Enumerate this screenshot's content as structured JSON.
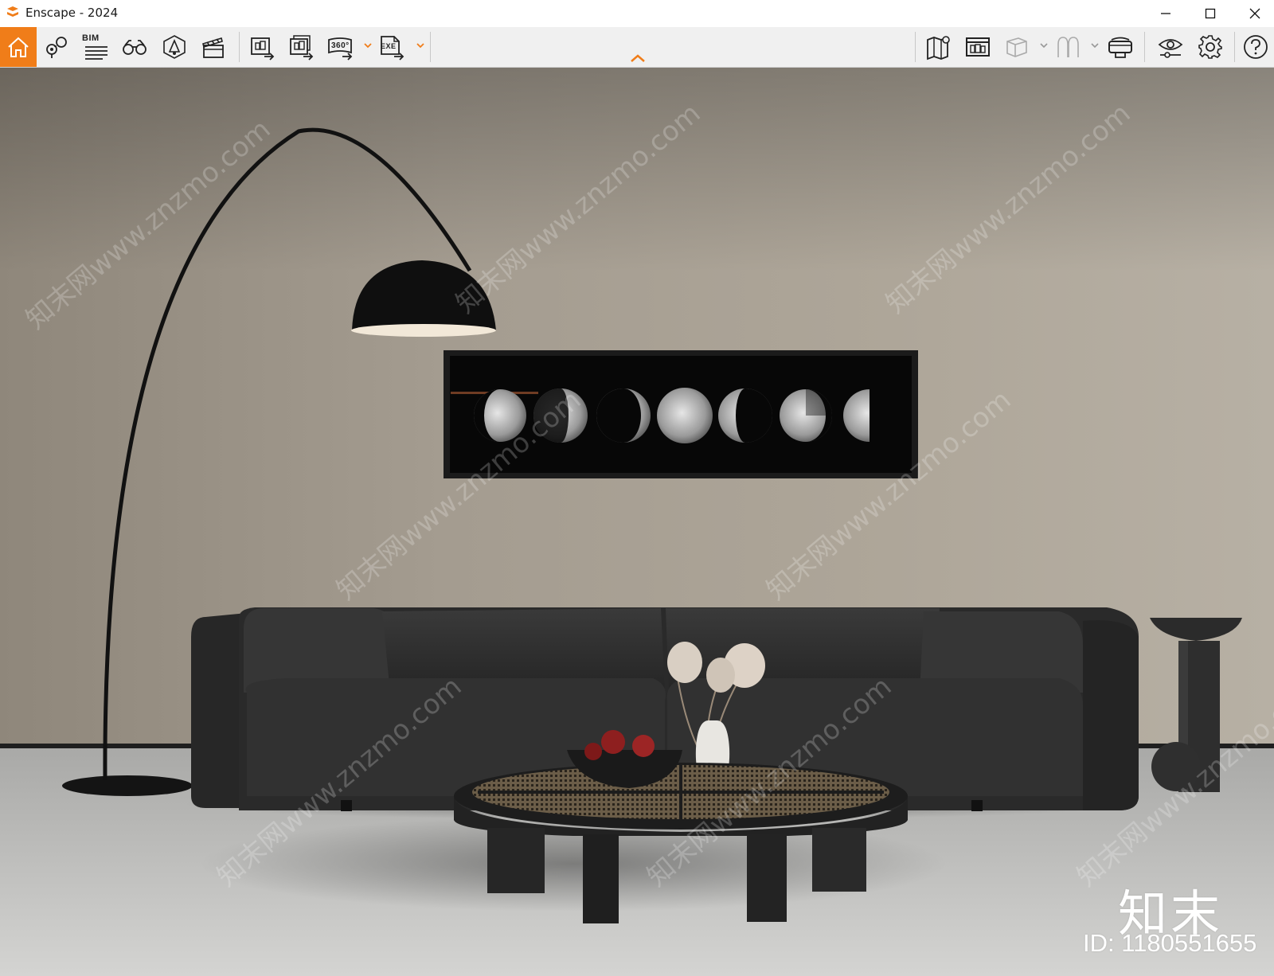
{
  "window": {
    "title": "Enscape - 2024",
    "controls": {
      "minimize": "minimize-icon",
      "maximize": "maximize-icon",
      "close": "close-icon"
    }
  },
  "toolbar": {
    "accent_color": "#f07d19",
    "left_tools": [
      {
        "name": "home",
        "icon": "home-icon"
      },
      {
        "name": "views",
        "icon": "map-pin-views-icon"
      },
      {
        "name": "bim",
        "icon": "bim-info-icon",
        "label": "BIM"
      },
      {
        "name": "binoculars",
        "icon": "binoculars-icon"
      },
      {
        "name": "light-view",
        "icon": "light-view-icon"
      },
      {
        "name": "video-editor",
        "icon": "clapperboard-icon"
      },
      {
        "name": "render-screenshot",
        "icon": "render-screenshot-icon"
      },
      {
        "name": "batch-render",
        "icon": "batch-render-icon"
      },
      {
        "name": "panorama",
        "icon": "panorama-360-icon",
        "label": "360°"
      },
      {
        "name": "export-exe",
        "icon": "export-exe-icon",
        "label": "EXE"
      }
    ],
    "right_tools": [
      {
        "name": "map",
        "icon": "map-icon"
      },
      {
        "name": "asset-library",
        "icon": "asset-library-icon"
      },
      {
        "name": "material-box",
        "icon": "box-icon"
      },
      {
        "name": "section",
        "icon": "arch-section-icon"
      },
      {
        "name": "vr-headset",
        "icon": "vr-headset-icon"
      },
      {
        "name": "visibility",
        "icon": "eye-settings-icon"
      },
      {
        "name": "settings",
        "icon": "gear-icon"
      },
      {
        "name": "help",
        "icon": "help-icon"
      }
    ]
  },
  "viewport": {
    "watermark_text": "知末网www.znzmo.com",
    "logo_text": "知末",
    "id_text": "ID: 1180551655"
  }
}
